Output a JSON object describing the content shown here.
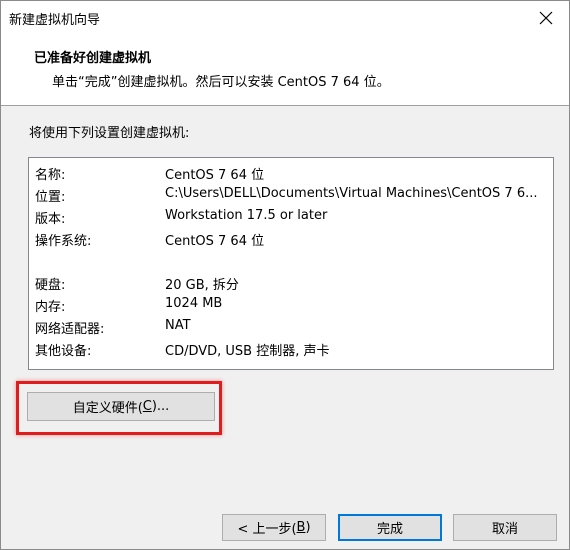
{
  "window": {
    "title": "新建虚拟机向导"
  },
  "header": {
    "title": "已准备好创建虚拟机",
    "subtitle": "单击“完成”创建虚拟机。然后可以安装 CentOS 7 64 位。"
  },
  "intro": "将使用下列设置创建虚拟机:",
  "summary": [
    {
      "label": "名称:",
      "value": "CentOS 7 64 位"
    },
    {
      "label": "位置:",
      "value": "C:\\Users\\DELL\\Documents\\Virtual Machines\\CentOS 7 6..."
    },
    {
      "label": "版本:",
      "value": "Workstation 17.5 or later"
    },
    {
      "label": "操作系统:",
      "value": "CentOS 7 64 位"
    },
    {
      "label": "硬盘:",
      "value": "20 GB, 拆分"
    },
    {
      "label": "内存:",
      "value": "1024 MB"
    },
    {
      "label": "网络适配器:",
      "value": "NAT"
    },
    {
      "label": "其他设备:",
      "value": "CD/DVD, USB 控制器, 声卡"
    }
  ],
  "buttons": {
    "customize_prefix": "自定义硬件(",
    "customize_key": "C",
    "customize_suffix": ")...",
    "back_prefix": "< 上一步(",
    "back_key": "B",
    "back_suffix": ")",
    "finish": "完成",
    "cancel": "取消"
  },
  "colors": {
    "highlight": "#e11c1c",
    "primary_border": "#0078d7",
    "button_face": "#e1e1e1"
  }
}
